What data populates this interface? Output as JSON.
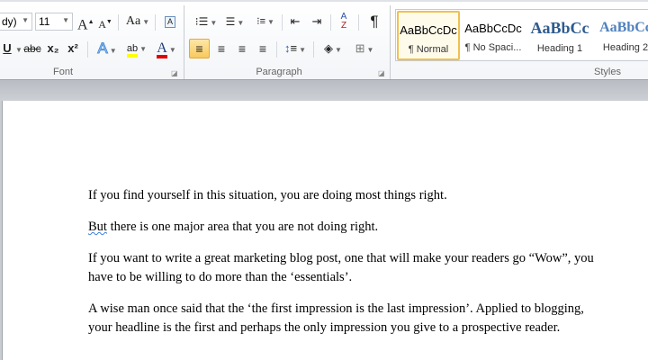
{
  "font_group": {
    "label": "Font",
    "font_name": "dy)",
    "font_size": "11",
    "grow_font": "A",
    "shrink_font": "A",
    "change_case": "Aa",
    "underline": "U",
    "strikethrough": "abc",
    "subscript": "x₂",
    "superscript": "x²",
    "text_effects": "A",
    "highlight": "ab",
    "font_color": "A",
    "highlight_color": "#ffff00",
    "font_color_value": "#e00000"
  },
  "paragraph_group": {
    "label": "Paragraph",
    "pilcrow": "¶"
  },
  "styles_group": {
    "label": "Styles",
    "items": [
      {
        "preview": "AaBbCcDc",
        "name": "¶ Normal"
      },
      {
        "preview": "AaBbCcDc",
        "name": "¶ No Spaci..."
      },
      {
        "preview": "AaBbCc",
        "name": "Heading 1"
      },
      {
        "preview": "AaBbCc",
        "name": "Heading 2"
      }
    ]
  },
  "document": {
    "paragraphs": [
      "If you find yourself in this situation, you are doing most things right.",
      "there is one major area that you are not doing right.",
      "If you want to write a great marketing blog post, one that will make your readers go “Wow”, you",
      "have to be willing to do more than the ‘essentials’.",
      "A wise man once said that the ‘the first impression is the last impression’.  Applied to blogging,",
      "your headline is the first and perhaps the only impression  you give to a prospective reader."
    ],
    "squiggle_word": "But"
  }
}
